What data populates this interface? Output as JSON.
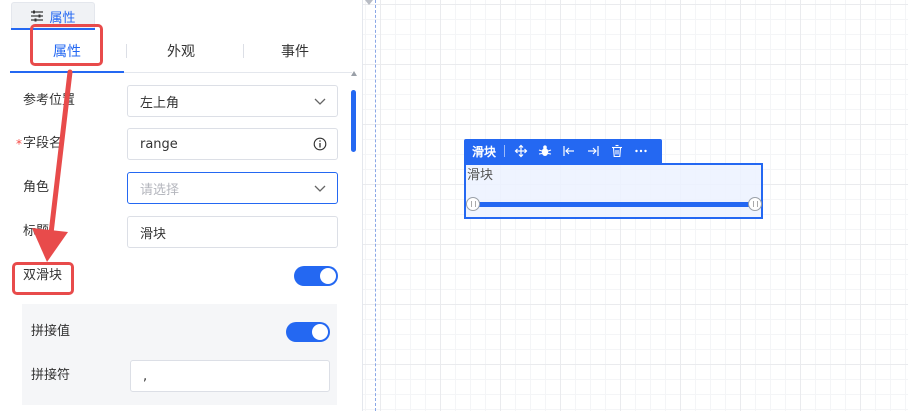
{
  "panel": {
    "header_tab": {
      "label": "属性",
      "icon": "sliders-icon"
    },
    "tabs": [
      {
        "label": "属性",
        "active": true
      },
      {
        "label": "外观",
        "active": false
      },
      {
        "label": "事件",
        "active": false
      }
    ],
    "fields": {
      "ref_position": {
        "label": "参考位置",
        "value": "左上角",
        "icon": "chevron-down-icon"
      },
      "field_name": {
        "label": "字段名",
        "required_mark": "*",
        "value": "range",
        "icon": "info-icon"
      },
      "role": {
        "label": "角色",
        "placeholder": "请选择",
        "icon": "chevron-down-icon"
      },
      "title": {
        "label": "标题",
        "value": "滑块"
      },
      "dual_slider": {
        "label": "双滑块",
        "on": true
      },
      "join_value": {
        "label": "拼接值",
        "on": true
      },
      "separator": {
        "label": "拼接符",
        "value": ","
      }
    }
  },
  "canvas": {
    "component": {
      "name": "滑块",
      "label": "滑块",
      "toolbar_icons": [
        "move-icon",
        "bug-icon",
        "align-left-icon",
        "align-right-icon",
        "delete-icon",
        "more-icon"
      ],
      "range": [
        0,
        100
      ]
    }
  },
  "colors": {
    "accent": "#2468f2",
    "annotation": "#e84b4b"
  }
}
